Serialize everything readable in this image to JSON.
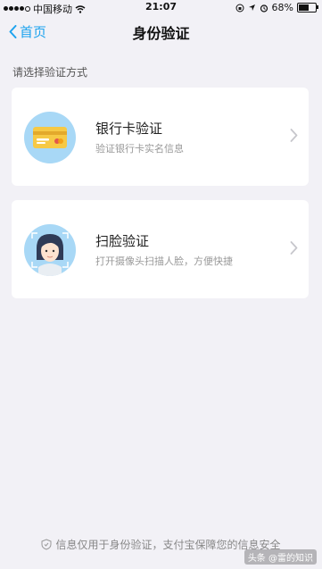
{
  "status_bar": {
    "carrier": "中国移动",
    "time": "21:07",
    "battery": "68%",
    "battery_level": 0.68
  },
  "nav": {
    "back_label": "首页",
    "title": "身份验证"
  },
  "section_label": "请选择验证方式",
  "options": [
    {
      "title": "银行卡验证",
      "subtitle": "验证银行卡实名信息",
      "icon": "bank-card-icon"
    },
    {
      "title": "扫脸验证",
      "subtitle": "打开摄像头扫描人脸，方便快捷",
      "icon": "face-scan-icon"
    }
  ],
  "footer": {
    "text": "信息仅用于身份验证，支付宝保障您的信息安全",
    "icon": "shield-icon"
  },
  "watermark": "头条 @雷的知识",
  "colors": {
    "accent": "#1ea3ee",
    "background": "#f2f1f6",
    "icon_bg": "#a8d8f6",
    "card_yellow": "#f6c945"
  }
}
